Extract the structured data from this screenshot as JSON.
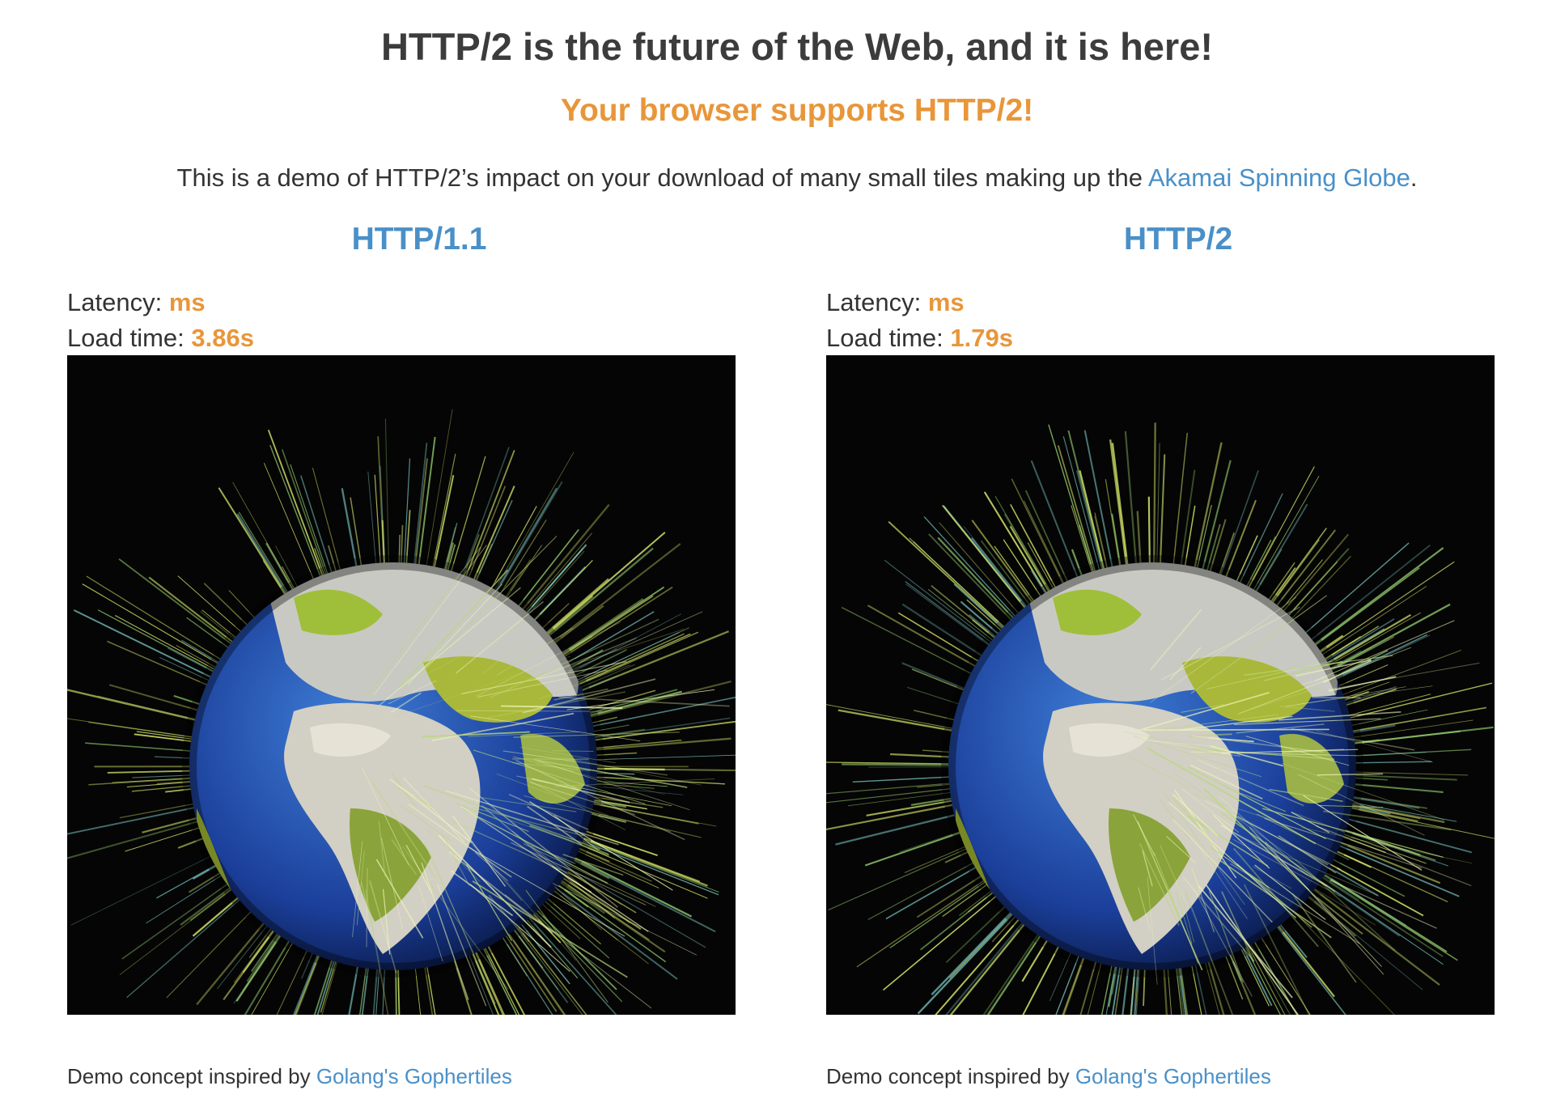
{
  "header": {
    "title": "HTTP/2 is the future of the Web, and it is here!",
    "support_message": "Your browser supports HTTP/2!",
    "intro_text": "This is a demo of HTTP/2’s impact on your download of many small tiles making up the ",
    "intro_link": "Akamai Spinning Globe",
    "intro_suffix": "."
  },
  "columns": [
    {
      "heading": "HTTP/1.1",
      "latency_label": "Latency: ",
      "latency_value": "ms",
      "load_label": "Load time: ",
      "load_value": "3.86s",
      "footer_text": "Demo concept inspired by ",
      "footer_link": "Golang's Gophertiles"
    },
    {
      "heading": "HTTP/2",
      "latency_label": "Latency: ",
      "latency_value": "ms",
      "load_label": "Load time: ",
      "load_value": "1.79s",
      "footer_text": "Demo concept inspired by ",
      "footer_link": "Golang's Gophertiles"
    }
  ],
  "colors": {
    "accent_orange": "#e8963a",
    "link_blue": "#4a90c8",
    "text_dark": "#333333",
    "globe_background": "#050505"
  },
  "icons": {
    "globe_image": "akamai-spinning-globe-image"
  }
}
